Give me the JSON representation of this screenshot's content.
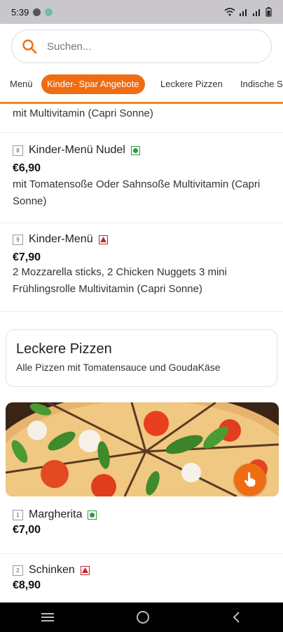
{
  "status": {
    "time": "5:39",
    "battery_icon": "battery-icon"
  },
  "search": {
    "placeholder": "Suchen..."
  },
  "tabs": [
    {
      "label": "Menü"
    },
    {
      "label": "Kinder- Spar Angebote",
      "active": true
    },
    {
      "label": "Leckere Pizzen"
    },
    {
      "label": "Indische S"
    }
  ],
  "items": [
    {
      "partial_desc": "mit Multivitamin (Capri Sonne)"
    },
    {
      "number": "8",
      "name": "Kinder-Menü Nudel",
      "diet": "veg",
      "price": "€6,90",
      "desc": "mit Tomatensoße Oder Sahnsoße Multivitamin (Capri Sonne)"
    },
    {
      "number": "9",
      "name": "Kinder-Menü",
      "diet": "nonveg",
      "price": "€7,90",
      "desc": "2 Mozzarella sticks, 2 Chicken Nuggets 3 mini Frühlingsrolle Multivitamin (Capri Sonne)"
    }
  ],
  "category": {
    "title": "Leckere Pizzen",
    "subtitle": "Alle Pizzen mit Tomatensauce und GoudaKäse"
  },
  "pizzas": [
    {
      "number": "1",
      "name": "Margherita",
      "diet": "veg",
      "price": "€7,00"
    },
    {
      "number": "2",
      "name": "Schinken",
      "diet": "nonveg",
      "price": "€8,90"
    }
  ],
  "colors": {
    "accent": "#ef6c12",
    "veg": "#2e9a3a",
    "nonveg": "#c0272d"
  }
}
